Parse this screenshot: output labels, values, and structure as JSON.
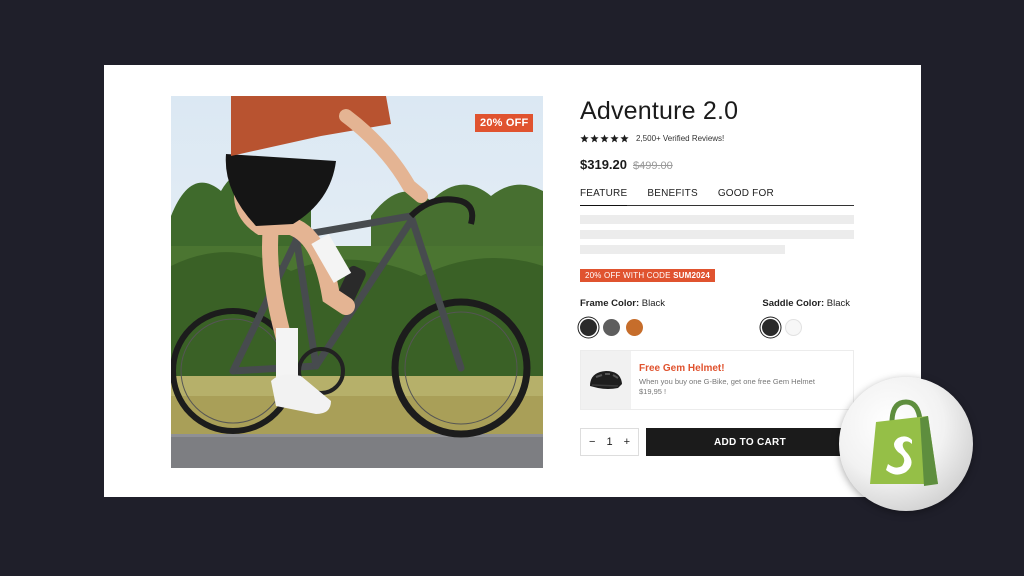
{
  "product": {
    "title": "Adventure 2.0",
    "rating_text": "2,500+ Verified Reviews!",
    "stars": 5,
    "price": "$319.20",
    "compare_price": "$499.00",
    "discount_badge": "20% OFF"
  },
  "tabs": [
    {
      "label": "FEATURE",
      "active": true
    },
    {
      "label": "BENEFITS",
      "active": false
    },
    {
      "label": "GOOD FOR",
      "active": false
    }
  ],
  "promo": {
    "text": "20% OFF WITH CODE ",
    "code": "SUM2024"
  },
  "options": {
    "frame": {
      "label": "Frame Color:",
      "value": "Black",
      "swatches": [
        "#2a2a2a",
        "#5e5e5e",
        "#c66d2b"
      ],
      "selected": 0
    },
    "saddle": {
      "label": "Saddle Color:",
      "value": "Black",
      "swatches": [
        "#2a2a2a",
        "#f7f7f7"
      ],
      "selected": 0
    }
  },
  "gift": {
    "title": "Free Gem Helmet!",
    "description": "When you buy one G-Bike, get one free Gem Helmet $19,95 !"
  },
  "cart": {
    "quantity": "1",
    "minus": "−",
    "plus": "+",
    "button_label": "ADD TO CART"
  },
  "colors": {
    "accent": "#e0532f",
    "dark": "#1b1b1b",
    "background": "#1f1f2a",
    "shopify_green": "#95bf47"
  },
  "icons": {
    "badge": "shopify-bag-icon",
    "helmet": "helmet-icon",
    "star": "star-icon"
  }
}
